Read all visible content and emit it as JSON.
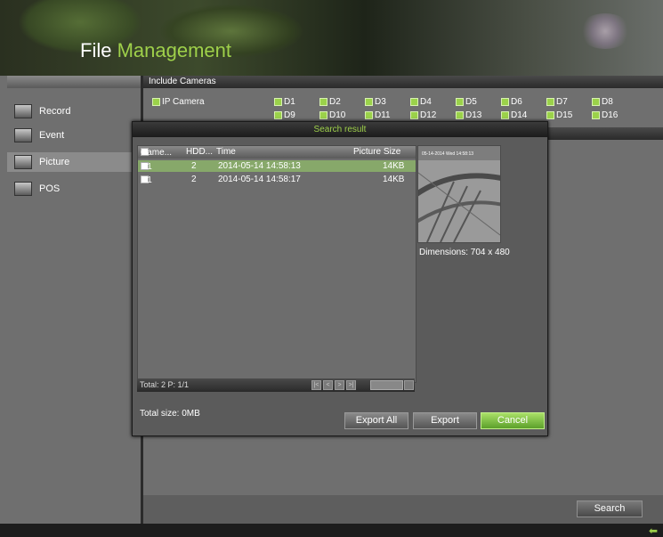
{
  "header": {
    "title_part1": "File ",
    "title_part2": "Management"
  },
  "sidebar": {
    "items": [
      {
        "label": "Record",
        "icon": "record-icon"
      },
      {
        "label": "Event",
        "icon": "event-icon"
      },
      {
        "label": "Picture",
        "icon": "picture-icon",
        "active": true
      },
      {
        "label": "POS",
        "icon": "pos-icon"
      }
    ]
  },
  "main": {
    "include_cameras_label": "Include Cameras",
    "ip_camera_label": "IP Camera",
    "cameras": [
      "D1",
      "D2",
      "D3",
      "D4",
      "D5",
      "D6",
      "D7",
      "D8",
      "D9",
      "D10",
      "D11",
      "D12",
      "D13",
      "D14",
      "D15",
      "D16"
    ],
    "search_label": "Search"
  },
  "dialog": {
    "title": "Search result",
    "columns": {
      "camera": "Came...",
      "hdd": "HDD...",
      "time": "Time",
      "size": "Picture Size"
    },
    "rows": [
      {
        "camera": "D1",
        "hdd": "2",
        "time": "2014-05-14 14:58:13",
        "size": "14KB",
        "selected": true
      },
      {
        "camera": "D1",
        "hdd": "2",
        "time": "2014-05-14 14:58:17",
        "size": "14KB",
        "selected": false
      }
    ],
    "footer": "Total: 2  P: 1/1",
    "dimensions": "Dimensions: 704 x 480",
    "total_size": "Total size: 0MB",
    "export_all_label": "Export All",
    "export_label": "Export",
    "cancel_label": "Cancel",
    "preview_timestamp": "05-14-2014 Wed 14:58:13"
  },
  "colors": {
    "accent_green": "#9ed04a",
    "selected_row": "#87a86a"
  }
}
